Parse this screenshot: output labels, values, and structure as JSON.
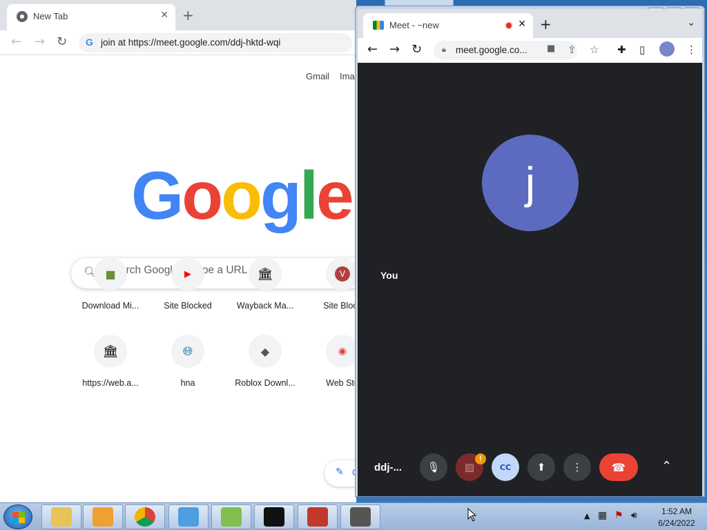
{
  "left_window": {
    "tab_title": "New Tab",
    "close_glyph": "✕",
    "new_tab_glyph": "+",
    "nav": {
      "back": "←",
      "forward": "→",
      "reload": "↻"
    },
    "omnibox_text": "join at https://meet.google.com/ddj-hktd-wqi",
    "top_links": [
      "Gmail",
      "Ima"
    ],
    "logo_letters": [
      {
        "ch": "G",
        "color": "#4285f4"
      },
      {
        "ch": "o",
        "color": "#ea4335"
      },
      {
        "ch": "o",
        "color": "#fbbc05"
      },
      {
        "ch": "g",
        "color": "#4285f4"
      },
      {
        "ch": "l",
        "color": "#34a853"
      },
      {
        "ch": "e",
        "color": "#ea4335"
      }
    ],
    "search_placeholder": "Search Google or type a URL",
    "shortcuts_row1": [
      {
        "label": "Download Mi...",
        "icon": "minecraft-block-icon"
      },
      {
        "label": "Site Blocked",
        "icon": "youtube-icon"
      },
      {
        "label": "Wayback Ma...",
        "icon": "archive-building-icon"
      },
      {
        "label": "Site Block",
        "icon": "v-letter-icon"
      }
    ],
    "shortcuts_row2": [
      {
        "label": "https://web.a...",
        "icon": "archive-building-icon"
      },
      {
        "label": "hna",
        "icon": "globe-icon"
      },
      {
        "label": "Roblox Downl...",
        "icon": "roblox-icon"
      },
      {
        "label": "Web Sto",
        "icon": "chrome-web-store-icon"
      }
    ],
    "customize_short": "C"
  },
  "right_window": {
    "tab_title": "Meet - ~new",
    "close_glyph": "✕",
    "new_tab_glyph": "+",
    "omnibox_text": "meet.google.co...",
    "avatar_letter": "j",
    "self_label": "You",
    "meeting_code": "ddj-...",
    "warning_glyph": "!"
  },
  "taskbar": {
    "apps": [
      {
        "name": "windows-explorer-icon",
        "color": "#e8c35a"
      },
      {
        "name": "media-player-icon",
        "color": "#f0a030"
      },
      {
        "name": "chrome-icon",
        "color": "#dd4b39"
      },
      {
        "name": "paint-icon",
        "color": "#4f9ee0"
      },
      {
        "name": "chart-app-icon",
        "color": "#7fbf4f"
      },
      {
        "name": "command-prompt-icon",
        "color": "#111111"
      },
      {
        "name": "toolbox-icon",
        "color": "#c0392b"
      },
      {
        "name": "java-app-icon",
        "color": "#555555"
      }
    ],
    "time": "1:52 AM",
    "date": "6/24/2022"
  }
}
